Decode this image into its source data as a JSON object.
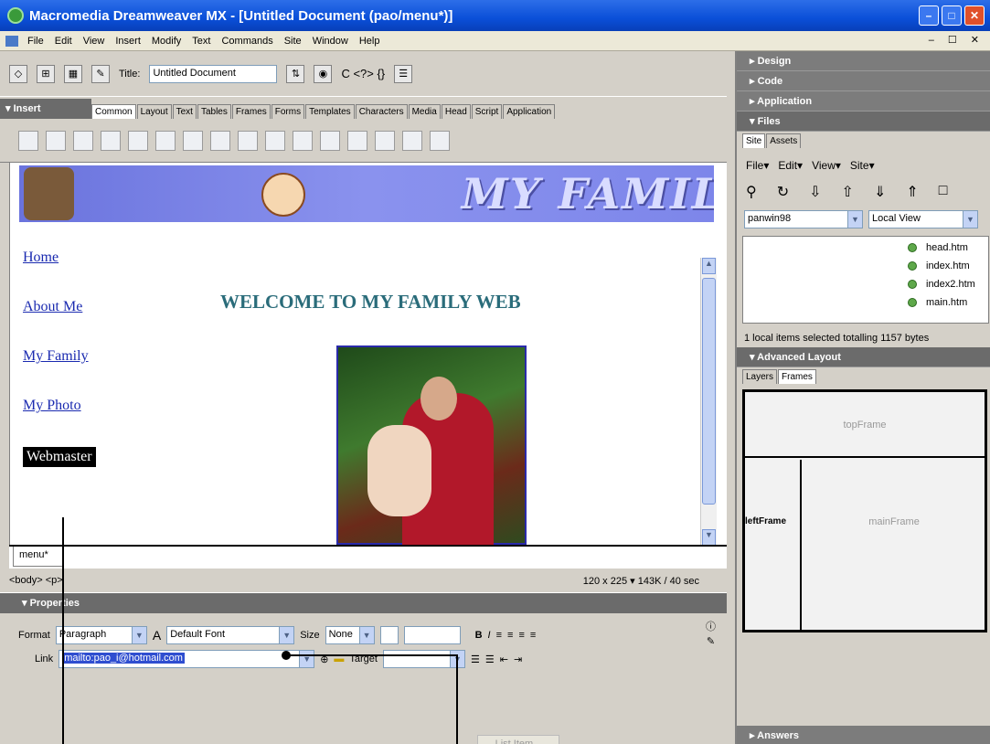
{
  "window": {
    "title": "Macromedia Dreamweaver MX - [Untitled Document (pao/menu*)]",
    "min": "–",
    "max": "□",
    "close": "✕"
  },
  "menubar": {
    "items": [
      "File",
      "Edit",
      "View",
      "Insert",
      "Modify",
      "Text",
      "Commands",
      "Site",
      "Window",
      "Help"
    ],
    "right_controls": "– ☐ ✕"
  },
  "toolbar": {
    "title_label": "Title:",
    "title_value": "Untitled Document",
    "code_glyphs": "C  <?>  {}",
    "icons": [
      "code-view-icon",
      "split-view-icon",
      "design-view-icon",
      "live-data-icon",
      "file-management-icon",
      "preview-browser-icon",
      "refresh-icon",
      "reference-icon",
      "code-nav-icon",
      "view-options-icon"
    ]
  },
  "insert_bar": {
    "heading": "Insert",
    "tabs": [
      "Common",
      "Layout",
      "Text",
      "Tables",
      "Frames",
      "Forms",
      "Templates",
      "Characters",
      "Media",
      "Head",
      "Script",
      "Application"
    ],
    "active_tab": "Common"
  },
  "document": {
    "banner_title": "MY FAMIL",
    "nav": [
      "Home",
      "About Me",
      "My Family",
      "My Photo"
    ],
    "nav_selected": "Webmaster",
    "welcome": "WELCOME TO MY FAMILY WEB",
    "tab": "menu*"
  },
  "statusbar": {
    "tags": "<body> <p>",
    "size_info": "120 x 225 ▾  143K / 40 sec"
  },
  "properties": {
    "heading": "Properties",
    "format_label": "Format",
    "format_value": "Paragraph",
    "font_value": "Default Font",
    "size_label": "Size",
    "size_value": "None",
    "link_label": "Link",
    "link_value": "mailto:pao_i@hotmail.com",
    "target_label": "Target",
    "target_value": "",
    "list_item": "List Item..."
  },
  "right_panel": {
    "design": "Design",
    "code": "Code",
    "application": "Application",
    "files": "Files",
    "files_tabs": [
      "Site",
      "Assets"
    ],
    "files_menu": [
      "File▾",
      "Edit▾",
      "View▾",
      "Site▾"
    ],
    "site_select": "panwin98",
    "view_select": "Local View",
    "files_list": [
      "head.htm",
      "index.htm",
      "index2.htm",
      "main.htm"
    ],
    "files_status": "1 local items selected totalling 1157 bytes",
    "advanced_layout": "Advanced Layout",
    "layout_tabs": [
      "Layers",
      "Frames"
    ],
    "frames": {
      "top": "topFrame",
      "left": "leftFrame",
      "main": "mainFrame"
    },
    "answers": "Answers"
  },
  "colors": {
    "titlebar": "#0a4fd8",
    "panel_head": "#6b6b6b",
    "link": "#1a2ab0",
    "welcome": "#2a6c7a"
  }
}
